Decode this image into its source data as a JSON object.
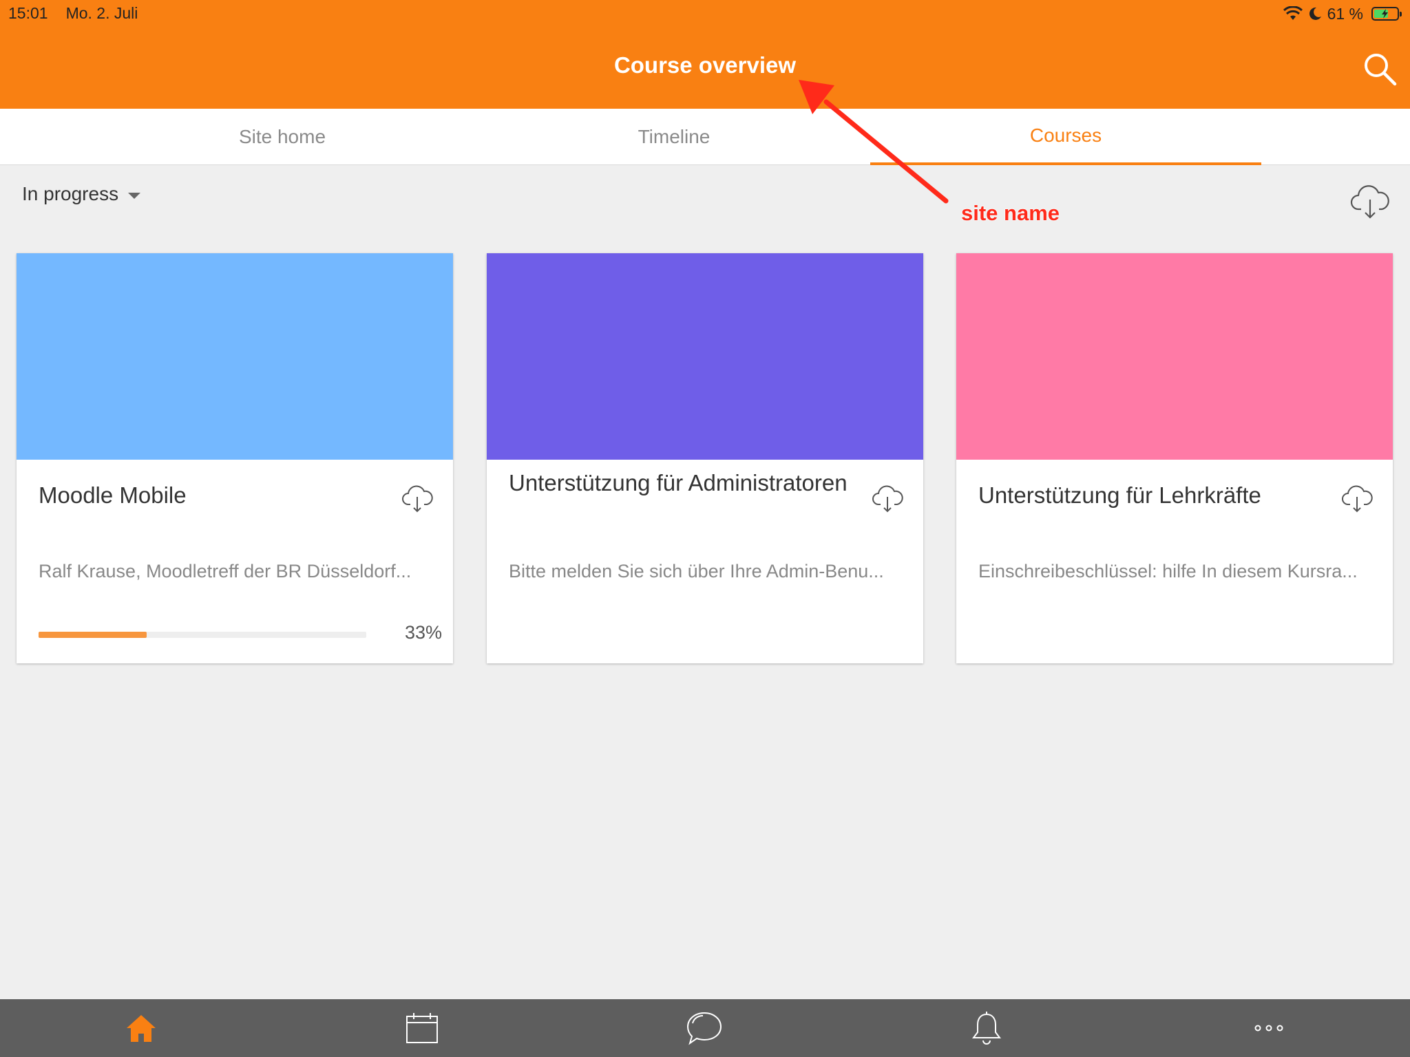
{
  "status_bar": {
    "time": "15:01",
    "date": "Mo. 2. Juli",
    "battery": "61 %",
    "battery_level": 0.61
  },
  "header": {
    "title": "Course overview"
  },
  "tabs": [
    {
      "label": "Site home"
    },
    {
      "label": "Timeline"
    },
    {
      "label": "Courses",
      "active": true
    }
  ],
  "filter": {
    "selected": "In progress"
  },
  "courses": [
    {
      "title": "Moodle Mobile",
      "summary": "Ralf Krause, Moodletreff der BR Düsseldorf...",
      "progress": 33,
      "progress_label": "33%",
      "color": "#74b8ff"
    },
    {
      "title": "Unterstützung für Administratoren",
      "summary": "Bitte melden Sie sich über Ihre Admin-Benu...",
      "color": "#6f5ee8"
    },
    {
      "title": "Unterstützung für Lehrkräfte",
      "summary": "Einschreibeschlüssel: hilfe In diesem Kursra...",
      "color": "#ff7aa6"
    }
  ],
  "annotation": {
    "label": "site name",
    "color": "#ff2a1a"
  },
  "bottom_tabs": [
    {
      "icon": "home-icon",
      "active": true
    },
    {
      "icon": "calendar-icon"
    },
    {
      "icon": "messages-icon"
    },
    {
      "icon": "notifications-icon"
    },
    {
      "icon": "more-icon"
    }
  ],
  "colors": {
    "brand": "#f98012",
    "tabbar": "#5e5e5e"
  }
}
